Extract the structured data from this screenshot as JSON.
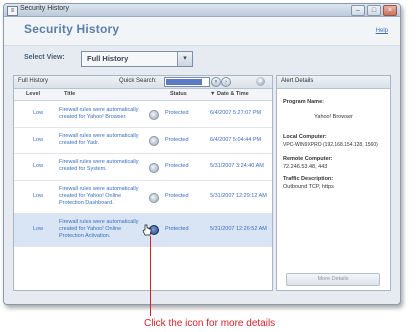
{
  "window": {
    "title": "Security History",
    "buttons": [
      "–",
      "□",
      "×"
    ]
  },
  "header": {
    "page_title": "Security History",
    "help_label": "Help"
  },
  "view": {
    "label": "Select View:",
    "selected": "Full History",
    "dropdown_glyph": "▾"
  },
  "list": {
    "panel_title": "Full History",
    "quick_search_label": "Quick Search:",
    "quick_search_value": "",
    "columns": {
      "level": "Level",
      "title": "Title",
      "status": "Status",
      "date": "▼ Date & Time"
    },
    "rows": [
      {
        "level": "Low",
        "title": "Firewall rules were automatically created for Yahoo! Browser.",
        "status": "Protected",
        "date": "6/4/2007 5:27:07 PM",
        "selected": false
      },
      {
        "level": "Low",
        "title": "Firewall rules were automatically created for Yadr.",
        "status": "Protected",
        "date": "6/4/2007 5:04:44 PM",
        "selected": false
      },
      {
        "level": "Low",
        "title": "Firewall rules were automatically created for System.",
        "status": "Protected",
        "date": "5/31/2007 3:24:40 AM",
        "selected": false
      },
      {
        "level": "Low",
        "title": "Firewall rules were automatically created for Yahoo! Online Protection Dashboard.",
        "status": "Protected",
        "date": "5/31/2007 12:29:12 AM",
        "selected": false
      },
      {
        "level": "Low",
        "title": "Firewall rules were automatically created for Yahoo! Online Protection Activation.",
        "status": "Protected",
        "date": "5/31/2007 12:26:52 AM",
        "selected": true
      }
    ]
  },
  "details": {
    "panel_title": "Alert Details",
    "program_name_label": "Program Name:",
    "program_name": "Yahoo! Browser",
    "local_computer_label": "Local Computer:",
    "local_computer": "VPC-WIN9XPRO (192.168.154.128, 1560)",
    "remote_computer_label": "Remote Computer:",
    "remote_computer": "72.246.53.48, 443",
    "traffic_label": "Traffic Description:",
    "traffic": "Outbound TCP, https",
    "more_details_label": "More Details"
  },
  "callout": {
    "text": "Click the icon for more details",
    "color": "#d3242a"
  },
  "colors": {
    "accent": "#5b7fa8",
    "link": "#3a6fc1",
    "selected_row": "#d9e5f4"
  }
}
